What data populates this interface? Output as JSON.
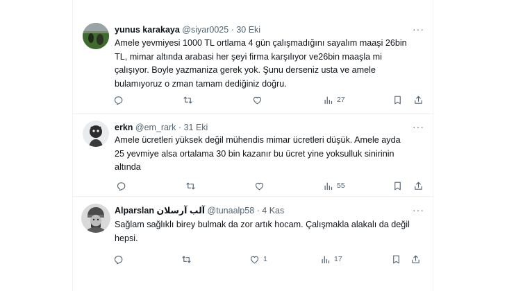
{
  "tweets": [
    {
      "name": "yunus karakaya",
      "handle": "@siyar0025",
      "separator": "·",
      "date": "30 Eki",
      "text": "Amele yevmiyesi 1000 TL ortlama 4 gün çalışmadığını sayalım maaşi 26bin\nTL, mimar altında arabasi her şeyi firma karşılıyor ve26bin maaşla mi\nçalışıyor. Boyle yazmaniza gerek yok. Şunu derseniz usta ve amele\nbulamıyoruz  o zman tamam dediğiniz doğru.",
      "reply_count": "",
      "retweet_count": "",
      "like_count": "",
      "view_count": "27"
    },
    {
      "name": "erkn",
      "handle": "@em_rark",
      "separator": "·",
      "date": "31 Eki",
      "text": "Amele ücretleri yüksek değil mühendis mimar ücretleri düşük. Amele ayda\n25 yevmiye alsa ortalama 30 bin kazanır bu ücret yine yoksulluk sinirinin\naltında",
      "reply_count": "",
      "retweet_count": "",
      "like_count": "",
      "view_count": "55"
    },
    {
      "name": "Alparslan آلب آرسلان",
      "handle": "@tunaalp58",
      "separator": "·",
      "date": "4 Kas",
      "text": "Sağlam sağlıklı birey bulmak da zor artık hocam. Çalışmakla alakalı da değil\nhepsi.",
      "reply_count": "",
      "retweet_count": "",
      "like_count": "1",
      "view_count": "17"
    }
  ],
  "icons": {
    "reply": "reply-icon",
    "retweet": "retweet-icon",
    "like": "like-icon",
    "views": "views-icon",
    "bookmark": "bookmark-icon",
    "share": "share-icon",
    "more": "more-icon"
  },
  "more_glyph": "···",
  "colors": {
    "text": "#0f1419",
    "secondary": "#536471",
    "divider": "#eff3f4"
  }
}
